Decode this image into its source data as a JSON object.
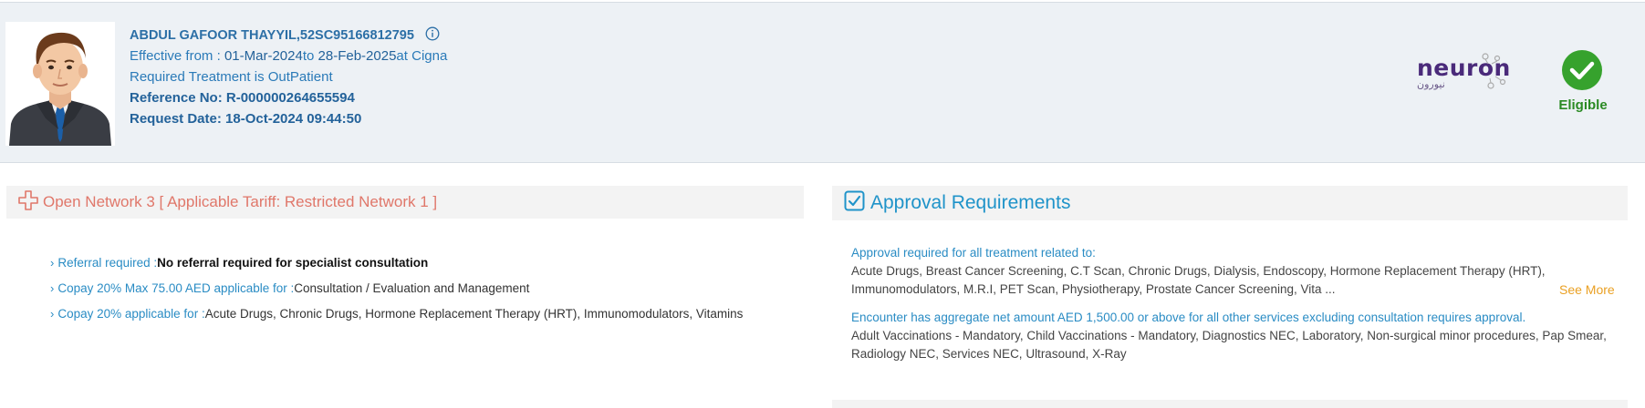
{
  "member": {
    "name": "ABDUL GAFOOR THAYYIL,",
    "member_id": "52SC95166812795",
    "effective_prefix": "Effective from : ",
    "effective_from": "01-Mar-2024",
    "to_word": "to ",
    "effective_to": "28-Feb-2025",
    "at_word": "at ",
    "insurer": "Cigna",
    "treatment_text": "Required Treatment is OutPatient",
    "reference_label": "Reference No: ",
    "reference_no": "R-000000264655594",
    "request_label": "Request Date: ",
    "request_date": "18-Oct-2024 09:44:50"
  },
  "brand": {
    "name": "neuron",
    "arabic": "نيورون"
  },
  "status": {
    "label": "Eligible",
    "color": "#36a22d"
  },
  "network": {
    "title": "Open Network 3 [ Applicable Tariff: Restricted Network 1 ]",
    "items": [
      {
        "key": "Referral required :",
        "value": "No referral required for specialist consultation"
      },
      {
        "key": "Copay 20% Max 75.00 AED applicable for :",
        "value": "Consultation / Evaluation and Management"
      },
      {
        "key": "Copay 20% applicable for :",
        "value": "Acute Drugs, Chronic Drugs, Hormone Replacement Therapy (HRT), Immunomodulators, Vitamins"
      }
    ]
  },
  "approval": {
    "title": "Approval Requirements",
    "block1_title": "Approval required for all treatment related to:",
    "block1_line1": "Acute Drugs, Breast Cancer Screening, C.T Scan, Chronic Drugs, Dialysis, Endoscopy, Hormone Replacement Therapy (HRT),",
    "block1_line2": "Immunomodulators, M.R.I, PET Scan, Physiotherapy, Prostate Cancer Screening, Vita ...",
    "see_more": "See More",
    "block2_title": "Encounter has aggregate net amount AED 1,500.00 or above for all other services excluding consultation requires approval.",
    "block2_line1": "Adult Vaccinations - Mandatory, Child Vaccinations - Mandatory, Diagnostics NEC, Laboratory, Non-surgical minor procedures, Pap Smear,",
    "block2_line2": "Radiology NEC, Services NEC, Ultrasound, X-Ray"
  }
}
